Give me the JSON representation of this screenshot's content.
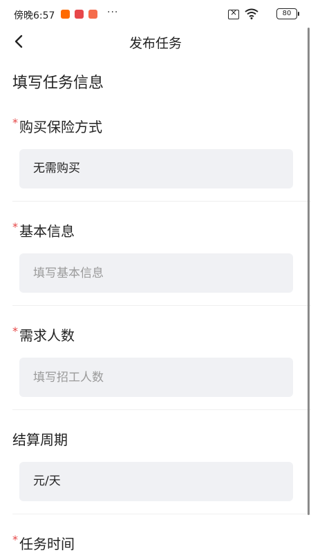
{
  "status_bar": {
    "time": "傍晚6:57",
    "more": "···",
    "battery": "80"
  },
  "nav": {
    "title": "发布任务"
  },
  "section_title": "填写任务信息",
  "fields": {
    "insurance": {
      "label": "购买保险方式",
      "value": "无需购买",
      "required": true
    },
    "basic_info": {
      "label": "基本信息",
      "placeholder": "填写基本信息",
      "required": true
    },
    "headcount": {
      "label": "需求人数",
      "placeholder": "填写招工人数",
      "required": true
    },
    "settlement": {
      "label": "结算周期",
      "value": "元/天",
      "required": false
    },
    "task_time": {
      "label": "任务时间",
      "required": true
    }
  },
  "required_mark": "*"
}
